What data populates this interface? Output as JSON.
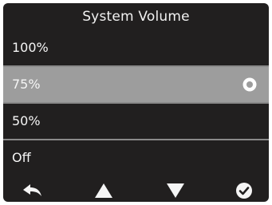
{
  "title": "System Volume",
  "options": [
    {
      "label": "100%",
      "selected": false
    },
    {
      "label": "75%",
      "selected": true
    },
    {
      "label": "50%",
      "selected": false
    },
    {
      "label": "Off",
      "selected": false
    }
  ],
  "nav_buttons": [
    {
      "icon": "back-arrow-icon"
    },
    {
      "icon": "up-triangle-icon"
    },
    {
      "icon": "down-triangle-icon"
    },
    {
      "icon": "check-circle-icon"
    }
  ],
  "colors": {
    "background": "#211f1f",
    "selected_row": "#9d9d9d",
    "divider": "#8a8a8a",
    "text": "#f5f5f5"
  }
}
